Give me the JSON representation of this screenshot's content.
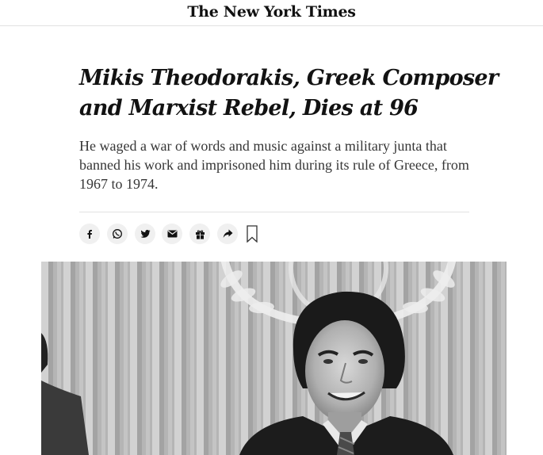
{
  "masthead": {
    "logo_text": "The New York Times"
  },
  "article": {
    "headline": "Mikis Theodorakis, Greek Composer and Marxist Rebel, Dies at 96",
    "summary": "He waged a war of words and music against a military junta that banned his work and imprisoned him during its rule of Greece, from 1967 to 1974."
  },
  "share": {
    "buttons": [
      {
        "icon": "facebook-icon"
      },
      {
        "icon": "whatsapp-icon"
      },
      {
        "icon": "twitter-icon"
      },
      {
        "icon": "email-icon"
      },
      {
        "icon": "gift-icon"
      },
      {
        "icon": "share-arrow-icon"
      }
    ],
    "bookmark_icon": "bookmark-icon"
  }
}
